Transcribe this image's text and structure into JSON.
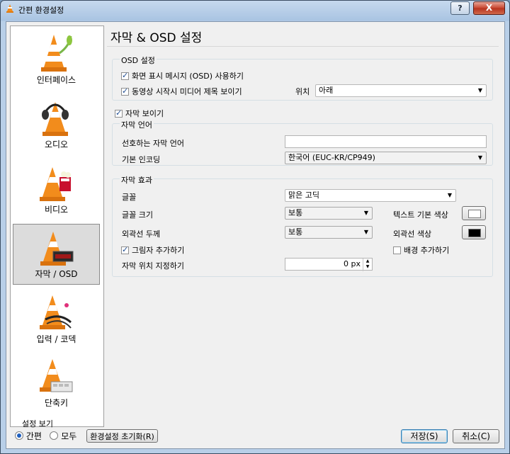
{
  "window": {
    "title": "간편 환경설정",
    "help": "?",
    "close": "X"
  },
  "sidebar": {
    "items": [
      {
        "label": "인터페이스",
        "icon": "interface-cone-icon"
      },
      {
        "label": "오디오",
        "icon": "audio-headphones-cone-icon"
      },
      {
        "label": "비디오",
        "icon": "video-cone-icon"
      },
      {
        "label": "자막 / OSD",
        "icon": "subtitle-cone-icon",
        "selected": true
      },
      {
        "label": "입력 / 코덱",
        "icon": "input-codec-cone-icon"
      },
      {
        "label": "단축키",
        "icon": "hotkeys-cone-icon"
      }
    ],
    "view": {
      "title": "설정 보기",
      "simple": "간편",
      "all": "모두",
      "selected": "simple"
    }
  },
  "main": {
    "heading": "자막 & OSD 설정",
    "osd": {
      "title": "OSD 설정",
      "enable_osd": "화면 표시 메시지 (OSD) 사용하기",
      "show_title": "동영상 시작시 미디어 제목 보이기",
      "position_label": "위치",
      "position_value": "아래"
    },
    "show_subtitles": "자막 보이기",
    "language": {
      "title": "자막 언어",
      "preferred_label": "선호하는 자막 언어",
      "preferred_value": "",
      "encoding_label": "기본 인코딩",
      "encoding_value": "한국어 (EUC-KR/CP949)"
    },
    "effects": {
      "title": "자막 효과",
      "font_label": "글꼴",
      "font_value": "맑은 고딕",
      "size_label": "글꼴 크기",
      "size_value": "보통",
      "text_color_label": "텍스트 기본 색상",
      "outline_label": "외곽선 두께",
      "outline_value": "보통",
      "outline_color_label": "외곽선 색상",
      "shadow_label": "그림자 추가하기",
      "background_label": "배경 추가하기",
      "position_label": "자막 위치 지정하기",
      "position_value": "0 px",
      "text_color": "#ffffff",
      "outline_color": "#000000"
    }
  },
  "footer": {
    "reset": "환경설정 초기화(R)",
    "save": "저장(S)",
    "cancel": "취소(C)"
  }
}
